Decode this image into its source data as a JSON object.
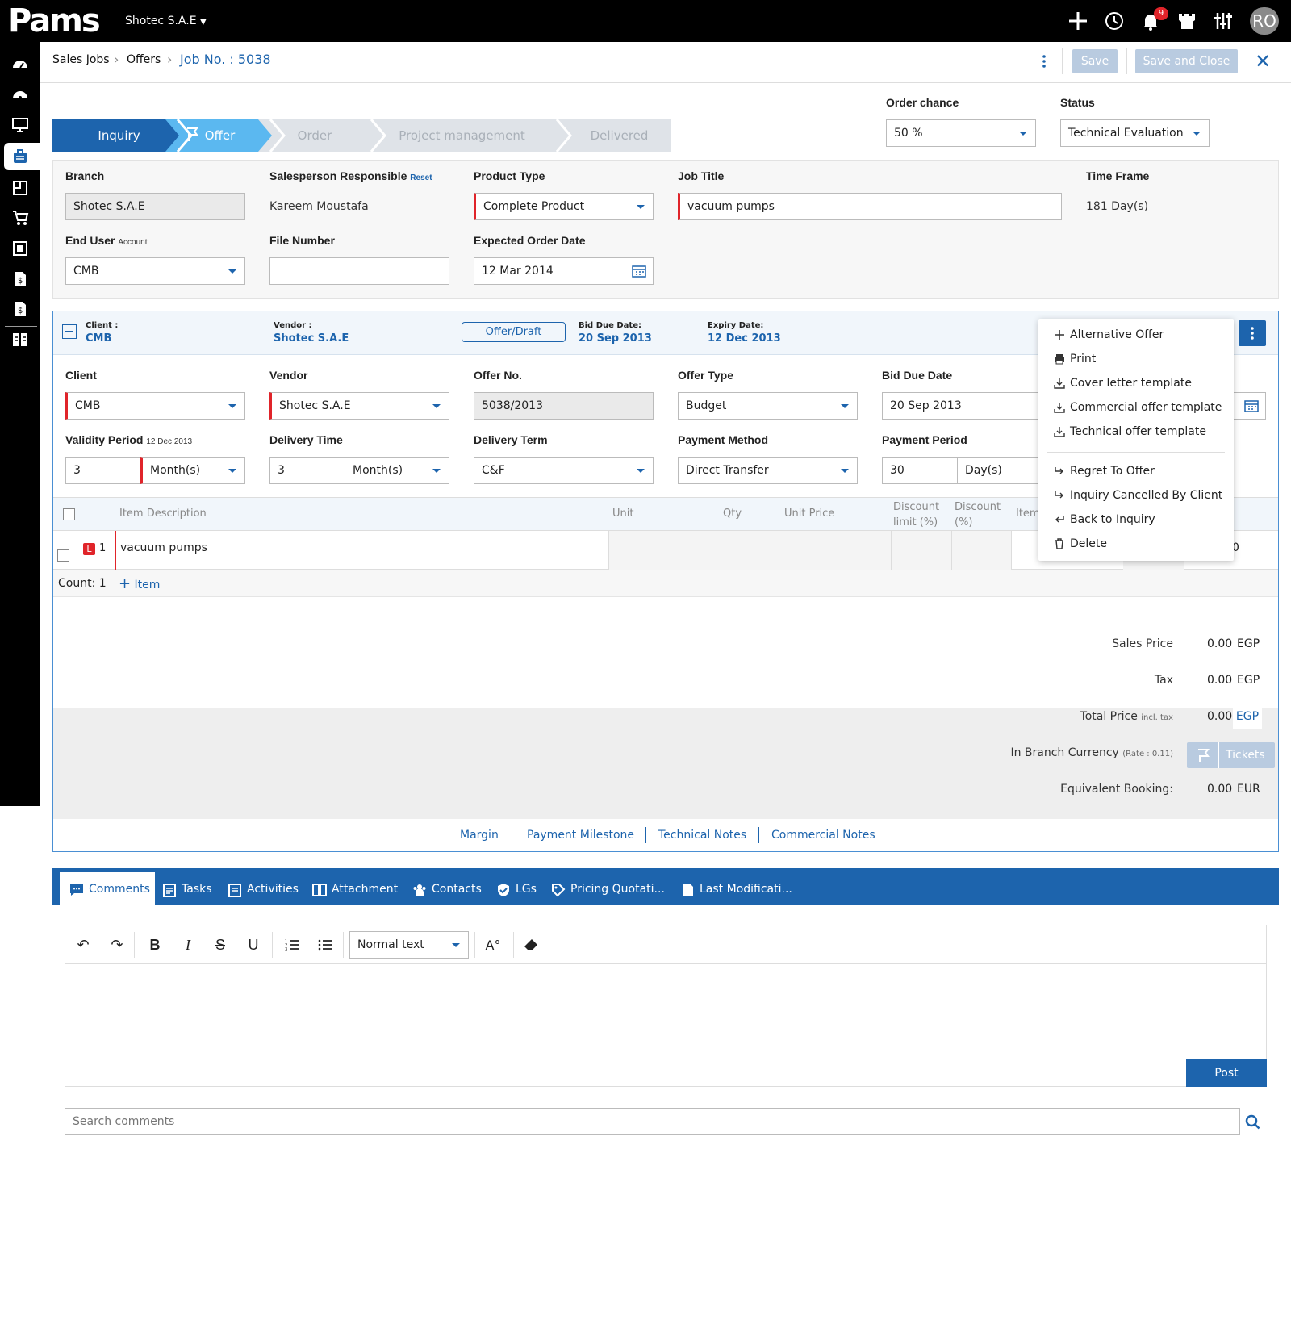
{
  "topbar": {
    "logo": "Pams",
    "company": "Shotec S.A.E",
    "notifications_count": "9",
    "avatar_initials": "RO"
  },
  "breadcrumb": {
    "items": [
      "Sales Jobs",
      "Offers"
    ],
    "current": "Job No. : 5038"
  },
  "header_actions": {
    "save": "Save",
    "save_and_close": "Save and Close"
  },
  "steps": [
    "Inquiry",
    "Offer",
    "Order",
    "Project management",
    "Delivered"
  ],
  "order_chance": {
    "label": "Order chance",
    "value": "50 %"
  },
  "status": {
    "label": "Status",
    "value": "Technical Evaluation"
  },
  "general": {
    "branch": {
      "label": "Branch",
      "value": "Shotec S.A.E"
    },
    "salesperson": {
      "label": "Salesperson Responsible",
      "reset": "Reset",
      "value": "Kareem Moustafa"
    },
    "product_type": {
      "label": "Product Type",
      "value": "Complete Product"
    },
    "job_title": {
      "label": "Job Title",
      "value": "vacuum pumps"
    },
    "time_frame": {
      "label": "Time Frame",
      "value": "181 Day(s)"
    },
    "end_user": {
      "label": "End User",
      "sub": "Account",
      "value": "CMB"
    },
    "file_number": {
      "label": "File Number",
      "value": ""
    },
    "expected_order_date": {
      "label": "Expected Order Date",
      "value": "12 Mar 2014"
    }
  },
  "offer_header": {
    "client_label": "Client :",
    "client": "CMB",
    "vendor_label": "Vendor :",
    "vendor": "Shotec S.A.E",
    "state": "Offer/Draft",
    "bid_due_label": "Bid Due Date:",
    "bid_due": "20 Sep 2013",
    "expiry_label": "Expiry Date:",
    "expiry": "12 Dec 2013"
  },
  "offer_form": {
    "client": {
      "label": "Client",
      "value": "CMB"
    },
    "vendor": {
      "label": "Vendor",
      "value": "Shotec S.A.E"
    },
    "offer_no": {
      "label": "Offer No.",
      "value": "5038/2013"
    },
    "offer_type": {
      "label": "Offer Type",
      "value": "Budget"
    },
    "bid_due_date": {
      "label": "Bid Due Date",
      "value": "20 Sep 2013"
    },
    "validity_period": {
      "label": "Validity Period",
      "sub": "12 Dec 2013",
      "value": "3",
      "unit": "Month(s)"
    },
    "delivery_time": {
      "label": "Delivery Time",
      "value": "3",
      "unit": "Month(s)"
    },
    "delivery_term": {
      "label": "Delivery Term",
      "value": "C&F"
    },
    "payment_method": {
      "label": "Payment Method",
      "value": "Direct Transfer"
    },
    "payment_period": {
      "label": "Payment Period",
      "value": "30",
      "unit": "Day(s)"
    }
  },
  "items_table": {
    "columns": [
      "Item Description",
      "Unit",
      "Qty",
      "Unit Price",
      "Discount limit (%)",
      "Discount (%)",
      "Item"
    ],
    "rows": [
      {
        "badge": "L",
        "no": "1",
        "description": "vacuum pumps",
        "trailing": "0"
      }
    ],
    "count_label": "Count: 1",
    "add_item": "Item"
  },
  "totals": {
    "sales_price": {
      "label": "Sales Price",
      "value": "0.00",
      "currency": "EGP"
    },
    "tax": {
      "label": "Tax",
      "value": "0.00",
      "currency": "EGP"
    },
    "total_price": {
      "label": "Total Price",
      "sub": "incl. tax",
      "value": "0.00",
      "currency": "EGP"
    },
    "branch_currency": {
      "label": "In Branch Currency",
      "sub": "(Rate : 0.11)",
      "tickets": "Tickets"
    },
    "equivalent_booking": {
      "label": "Equivalent Booking:",
      "value": "0.00",
      "currency": "EUR"
    }
  },
  "offer_links": [
    "Margin",
    "Payment Milestone",
    "Technical Notes",
    "Commercial Notes"
  ],
  "bottom_tabs": [
    "Comments",
    "Tasks",
    "Activities",
    "Attachment",
    "Contacts",
    "LGs",
    "Pricing Quotati...",
    "Last Modificati..."
  ],
  "editor": {
    "format": "Normal text",
    "post": "Post"
  },
  "search_comments": {
    "placeholder": "Search comments"
  },
  "context_menu": {
    "group1": [
      "Alternative Offer",
      "Print",
      "Cover letter template",
      "Commercial offer template",
      "Technical offer template"
    ],
    "group2": [
      "Regret To Offer",
      "Inquiry Cancelled By Client",
      "Back to Inquiry",
      "Delete"
    ]
  },
  "colors": {
    "primary": "#1d64ad",
    "step_active": "#1d64ad",
    "step_current": "#5bb8f0",
    "required": "#e0242a"
  }
}
